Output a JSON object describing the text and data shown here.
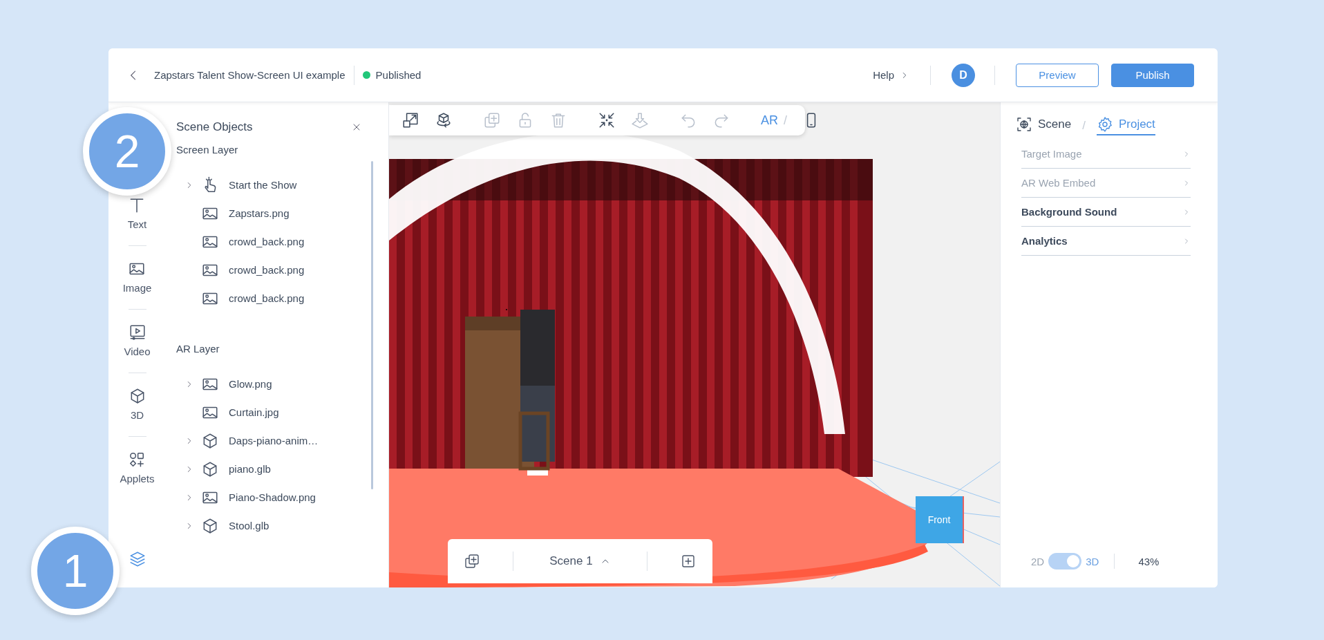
{
  "window": {
    "title": "Zapstars Talent Show-Screen UI example",
    "status": {
      "label": "Published",
      "color": "#22c77a"
    }
  },
  "header": {
    "help": "Help",
    "avatar": "D",
    "buttons": [
      {
        "label": "Preview",
        "kind": "secondary"
      },
      {
        "label": "Publish",
        "kind": "primary"
      }
    ]
  },
  "tool_rail": {
    "items": [
      {
        "label": "Text",
        "kind": "text"
      },
      {
        "label": "Image",
        "kind": "image"
      },
      {
        "label": "Video",
        "kind": "video"
      },
      {
        "label": "3D",
        "kind": "model"
      },
      {
        "label": "Applets",
        "kind": "applets"
      }
    ],
    "layers": {
      "selected": true
    }
  },
  "scene_objects": {
    "title": "Scene Objects",
    "groups": [
      {
        "title": "Screen Layer",
        "items": [
          {
            "label": "Start the Show",
            "kind": "button",
            "expandable": true
          },
          {
            "label": "Zapstars.png",
            "kind": "image",
            "expandable": false
          },
          {
            "label": "crowd_back.png",
            "kind": "image",
            "expandable": false
          },
          {
            "label": "crowd_back.png",
            "kind": "image",
            "expandable": false
          },
          {
            "label": "crowd_back.png",
            "kind": "image",
            "expandable": false
          }
        ]
      },
      {
        "title": "AR Layer",
        "items": [
          {
            "label": "Glow.png",
            "kind": "image",
            "expandable": true
          },
          {
            "label": "Curtain.jpg",
            "kind": "image",
            "expandable": false
          },
          {
            "label": "Daps-piano-anim…",
            "kind": "model",
            "expandable": true
          },
          {
            "label": "piano.glb",
            "kind": "model",
            "expandable": true
          },
          {
            "label": "Piano-Shadow.png",
            "kind": "image",
            "expandable": true
          },
          {
            "label": "Stool.glb",
            "kind": "model",
            "expandable": true
          }
        ]
      }
    ]
  },
  "toolbar": {
    "items": [
      {
        "kind": "resize",
        "disabled": false
      },
      {
        "kind": "rotate",
        "disabled": false
      },
      {
        "kind": "separator"
      },
      {
        "kind": "duplicate",
        "disabled": true
      },
      {
        "kind": "unlock",
        "disabled": true
      },
      {
        "kind": "trash",
        "disabled": true
      },
      {
        "kind": "separator"
      },
      {
        "kind": "collapse",
        "disabled": false
      },
      {
        "kind": "drop",
        "disabled": true
      },
      {
        "kind": "separator"
      },
      {
        "kind": "undo",
        "disabled": true
      },
      {
        "kind": "redo",
        "disabled": true
      },
      {
        "kind": "separator"
      },
      {
        "kind": "text",
        "label": "AR"
      },
      {
        "kind": "slash",
        "label": "/"
      },
      {
        "kind": "phone",
        "disabled": false
      }
    ]
  },
  "viewport": {
    "view_cube": "Front"
  },
  "scene_bar": {
    "label": "Scene 1"
  },
  "properties": {
    "tab_separator": "/",
    "tabs": [
      {
        "label": "Scene",
        "kind": "scene",
        "selected": false
      },
      {
        "label": "Project",
        "kind": "project",
        "selected": true
      }
    ],
    "items": [
      {
        "label": "Target Image",
        "disabled": true
      },
      {
        "label": "AR Web Embed",
        "disabled": true
      },
      {
        "label": "Background Sound",
        "disabled": false
      },
      {
        "label": "Analytics",
        "disabled": false
      }
    ],
    "view_toggle": {
      "off_label": "2D",
      "on_label": "3D",
      "on": true
    },
    "zoom": "43%"
  },
  "annotations": [
    {
      "label": "1",
      "kind": "bottom"
    },
    {
      "label": "2",
      "kind": "top"
    }
  ]
}
